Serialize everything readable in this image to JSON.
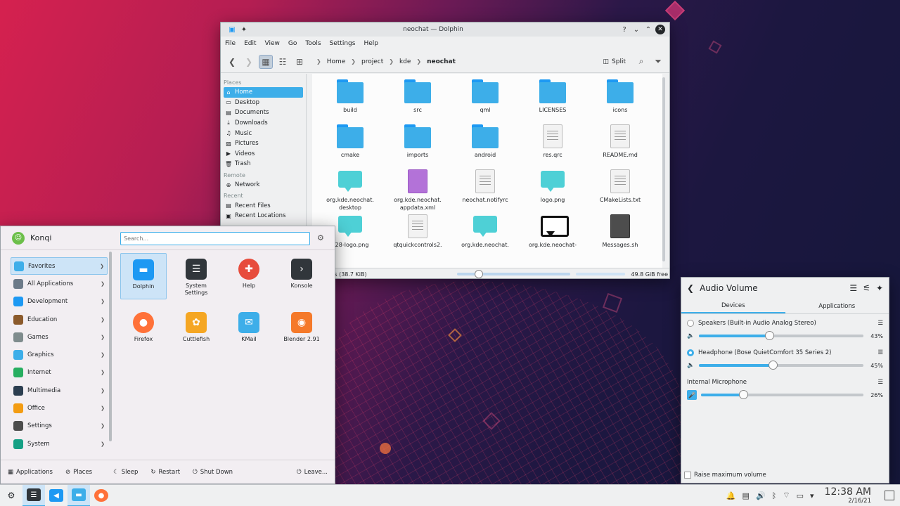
{
  "dolphin": {
    "title": "neochat — Dolphin",
    "menu": [
      "File",
      "Edit",
      "View",
      "Go",
      "Tools",
      "Settings",
      "Help"
    ],
    "breadcrumb": [
      "Home",
      "project",
      "kde",
      "neochat"
    ],
    "split_label": "Split",
    "places_header": "Places",
    "places": [
      "Home",
      "Desktop",
      "Documents",
      "Downloads",
      "Music",
      "Pictures",
      "Videos",
      "Trash"
    ],
    "remote_header": "Remote",
    "remote": [
      "Network"
    ],
    "recent_header": "Recent",
    "recent": [
      "Recent Files",
      "Recent Locations"
    ],
    "files": [
      {
        "name": "build",
        "type": "folder"
      },
      {
        "name": "src",
        "type": "folder"
      },
      {
        "name": "qml",
        "type": "folder"
      },
      {
        "name": "LICENSES",
        "type": "folder"
      },
      {
        "name": "icons",
        "type": "folder"
      },
      {
        "name": "cmake",
        "type": "folder"
      },
      {
        "name": "imports",
        "type": "folder"
      },
      {
        "name": "android",
        "type": "folder"
      },
      {
        "name": "res.qrc",
        "type": "doc"
      },
      {
        "name": "README.md",
        "type": "doc"
      },
      {
        "name": "org.kde.neochat.\ndesktop",
        "type": "chat"
      },
      {
        "name": "org.kde.neochat.\nappdata.xml",
        "type": "purple"
      },
      {
        "name": "neochat.notifyrc",
        "type": "doc"
      },
      {
        "name": "logo.png",
        "type": "chat"
      },
      {
        "name": "CMakeLists.txt",
        "type": "doc"
      },
      {
        "name": "128-logo.png",
        "type": "chat"
      },
      {
        "name": "qtquickcontrols2.",
        "type": "doc"
      },
      {
        "name": "org.kde.neochat.",
        "type": "chat"
      },
      {
        "name": "org.kde.neochat-",
        "type": "black"
      },
      {
        "name": "Messages.sh",
        "type": "dark"
      }
    ],
    "status_text": "s, 12 Files (38.7 KiB)",
    "free_space": "49.8 GiB free"
  },
  "kickoff": {
    "user": "Konqi",
    "search_placeholder": "Search...",
    "categories": [
      {
        "label": "Favorites",
        "color": "#3daee9"
      },
      {
        "label": "All Applications",
        "color": "#6c7a89"
      },
      {
        "label": "Development",
        "color": "#1d99f3"
      },
      {
        "label": "Education",
        "color": "#8b5a2b"
      },
      {
        "label": "Games",
        "color": "#7f8c8d"
      },
      {
        "label": "Graphics",
        "color": "#3daee9"
      },
      {
        "label": "Internet",
        "color": "#27ae60"
      },
      {
        "label": "Multimedia",
        "color": "#2c3e50"
      },
      {
        "label": "Office",
        "color": "#f39c12"
      },
      {
        "label": "Settings",
        "color": "#4d4d4d"
      },
      {
        "label": "System",
        "color": "#16a085"
      }
    ],
    "apps": [
      {
        "label": "Dolphin",
        "color": "#1d99f3"
      },
      {
        "label": "System\nSettings",
        "color": "#31363b"
      },
      {
        "label": "Help",
        "color": "#e74c3c"
      },
      {
        "label": "Konsole",
        "color": "#31363b"
      },
      {
        "label": "Firefox",
        "color": "#ff7139"
      },
      {
        "label": "Cuttlefish",
        "color": "#f5a623"
      },
      {
        "label": "KMail",
        "color": "#3daee9"
      },
      {
        "label": "Blender 2.91",
        "color": "#f5792a"
      }
    ],
    "footer": {
      "applications": "Applications",
      "places": "Places",
      "sleep": "Sleep",
      "restart": "Restart",
      "shutdown": "Shut Down",
      "leave": "Leave..."
    }
  },
  "audio": {
    "title": "Audio Volume",
    "tabs": [
      "Devices",
      "Applications"
    ],
    "devices": [
      {
        "name": "Speakers (Built-in Audio Analog Stereo)",
        "percent": "43%",
        "level": 43,
        "selected": false
      },
      {
        "name": "Headphone (Bose QuietComfort 35 Series 2)",
        "percent": "45%",
        "level": 45,
        "selected": true
      }
    ],
    "mic": {
      "name": "Internal Microphone",
      "percent": "26%",
      "level": 26
    },
    "raise_max": "Raise maximum volume"
  },
  "taskbar": {
    "time": "12:38 AM",
    "date": "2/16/21"
  }
}
